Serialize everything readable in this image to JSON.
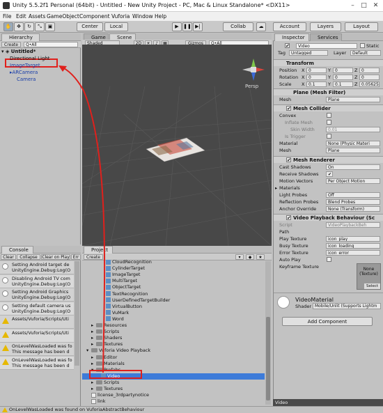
{
  "window": {
    "title": "Unity 5.5.2f1 Personal (64bit) - Untitled - New Unity Project - PC, Mac & Linux Standalone* <DX11>"
  },
  "menu": [
    "File",
    "Edit",
    "Assets",
    "GameObject",
    "Component",
    "Vuforia",
    "Window",
    "Help"
  ],
  "toolbar": {
    "center": "Center",
    "local": "Local",
    "collab": "Collab",
    "account": "Account",
    "layers": "Layers",
    "layout": "Layout"
  },
  "hierarchy": {
    "tab": "Hierarchy",
    "create": "Create",
    "search": "Q•All",
    "scene": "Untitled*",
    "items": [
      {
        "label": "Directional Light",
        "indent": 1
      },
      {
        "label": "ImageTarget",
        "indent": 1,
        "blue": true
      },
      {
        "label": "ARCamera",
        "indent": 1,
        "blue": true,
        "arrow": true
      },
      {
        "label": "Camera",
        "indent": 2,
        "blue": true
      }
    ]
  },
  "scene": {
    "tab_game": "Game",
    "tab_scene": "Scene",
    "shading": "Shaded",
    "mode2d": "2D",
    "gizmos": "Gizmos",
    "search": "Q•All",
    "persp": "Persp"
  },
  "inspector": {
    "tab": "Inspector",
    "tab2": "Services",
    "object_name": "Video",
    "static": "Static",
    "tag_label": "Tag",
    "tag": "Untagged",
    "layer_label": "Layer",
    "layer": "Default",
    "transform": {
      "title": "Transform",
      "rows": [
        {
          "label": "Position",
          "x": "0",
          "y": "0",
          "z": "0"
        },
        {
          "label": "Rotation",
          "x": "0",
          "y": "0",
          "z": "0"
        },
        {
          "label": "Scale",
          "x": "0.1",
          "y": "0.1",
          "z": "0.05625"
        }
      ]
    },
    "mesh_filter": {
      "title": "Plane (Mesh Filter)",
      "mesh_label": "Mesh",
      "mesh": "Plane"
    },
    "mesh_collider": {
      "title": "Mesh Collider",
      "convex": "Convex",
      "inflate": "Inflate Mesh",
      "skin": "Skin Width",
      "skin_val": "0.01",
      "trigger": "Is Trigger",
      "material": "Material",
      "material_val": "None (Physic Materi",
      "mesh": "Mesh",
      "mesh_val": "Plane"
    },
    "mesh_renderer": {
      "title": "Mesh Renderer",
      "rows": [
        {
          "label": "Cast Shadows",
          "val": "On"
        },
        {
          "label": "Receive Shadows",
          "val": "✔"
        },
        {
          "label": "Motion Vectors",
          "val": "Per Object Motion"
        }
      ],
      "materials": "Materials",
      "rows2": [
        {
          "label": "Light Probes",
          "val": "Off"
        },
        {
          "label": "Reflection Probes",
          "val": "Blend Probes"
        },
        {
          "label": "Anchor Override",
          "val": "None (Transform)"
        }
      ]
    },
    "video": {
      "title": "Video Playback Behaviour (Sc",
      "script": "Script",
      "script_val": "VideoPlaybackBeh",
      "path": "Path",
      "play": "Play Texture",
      "play_val": "icon_play",
      "busy": "Busy Texture",
      "busy_val": "icon_loading",
      "error": "Error Texture",
      "error_val": "icon_error",
      "auto": "Auto Play",
      "keyframe": "Keyframe Texture",
      "none": "None",
      "texture": "(Texture)",
      "select": "Select"
    },
    "material": {
      "name": "VideoMaterial",
      "shader_label": "Shader",
      "shader": "Mobile/Unlit (Supports Lightm"
    },
    "add_component": "Add Component",
    "preview": "Video"
  },
  "console": {
    "tab": "Console",
    "clear": "Clear",
    "collapse": "Collapse",
    "clear_on_play": "Clear on Play",
    "error_pause": "Err",
    "items": [
      {
        "type": "info",
        "l1": "Setting Android target de",
        "l2": "UnityEngine.Debug:Log(O"
      },
      {
        "type": "info",
        "l1": "Disabling Android TV com",
        "l2": "UnityEngine.Debug:Log(O"
      },
      {
        "type": "info",
        "l1": "Setting Android Graphics",
        "l2": "UnityEngine.Debug:Log(O"
      },
      {
        "type": "info",
        "l1": "Setting default camera us",
        "l2": "UnityEngine.Debug:Log(O"
      },
      {
        "type": "warn",
        "l1": "Assets/Vuforia/Scripts/Uti",
        "l2": ""
      },
      {
        "type": "warn",
        "l1": "Assets/Vuforia/Scripts/Uti",
        "l2": ""
      },
      {
        "type": "warn",
        "l1": "OnLevelWasLoaded was fo",
        "l2": "This message has been d"
      },
      {
        "type": "warn",
        "l1": "OnLevelWasLoaded was fo",
        "l2": "This message has been d"
      }
    ]
  },
  "project": {
    "tab": "Project",
    "create": "Create",
    "items": [
      {
        "label": "CloudRecognition",
        "indent": 3,
        "icon": "cs"
      },
      {
        "label": "CylinderTarget",
        "indent": 3,
        "icon": "cs"
      },
      {
        "label": "ImageTarget",
        "indent": 3,
        "icon": "cs"
      },
      {
        "label": "MultiTarget",
        "indent": 3,
        "icon": "cs"
      },
      {
        "label": "ObjectTarget",
        "indent": 3,
        "icon": "cs"
      },
      {
        "label": "TextRecognition",
        "indent": 3,
        "icon": "cs"
      },
      {
        "label": "UserDefinedTargetBuilder",
        "indent": 3,
        "icon": "cs"
      },
      {
        "label": "VirtualButton",
        "indent": 3,
        "icon": "cs"
      },
      {
        "label": "VuMark",
        "indent": 3,
        "icon": "cs"
      },
      {
        "label": "Word",
        "indent": 3,
        "icon": "cs"
      },
      {
        "label": "Resources",
        "indent": 1,
        "icon": "folder"
      },
      {
        "label": "Scripts",
        "indent": 1,
        "icon": "folder"
      },
      {
        "label": "Shaders",
        "indent": 1,
        "icon": "folder"
      },
      {
        "label": "Textures",
        "indent": 1,
        "icon": "folder"
      },
      {
        "label": "Vuforia Video Playback",
        "indent": 0,
        "icon": "folder",
        "open": true
      },
      {
        "label": "Editor",
        "indent": 1,
        "icon": "folder"
      },
      {
        "label": "Materials",
        "indent": 1,
        "icon": "folder"
      },
      {
        "label": "Prefabs",
        "indent": 1,
        "icon": "folder",
        "open": true
      },
      {
        "label": "Video",
        "indent": 2,
        "icon": "cs",
        "selected": true
      },
      {
        "label": "Scripts",
        "indent": 1,
        "icon": "folder"
      },
      {
        "label": "Textures",
        "indent": 1,
        "icon": "folder"
      },
      {
        "label": "license_3rdpartynotice",
        "indent": 0,
        "icon": "file"
      },
      {
        "label": "link",
        "indent": 0,
        "icon": "file"
      }
    ]
  },
  "status": "OnLevelWasLoaded was found on VuforiaAbstractBehaviour"
}
